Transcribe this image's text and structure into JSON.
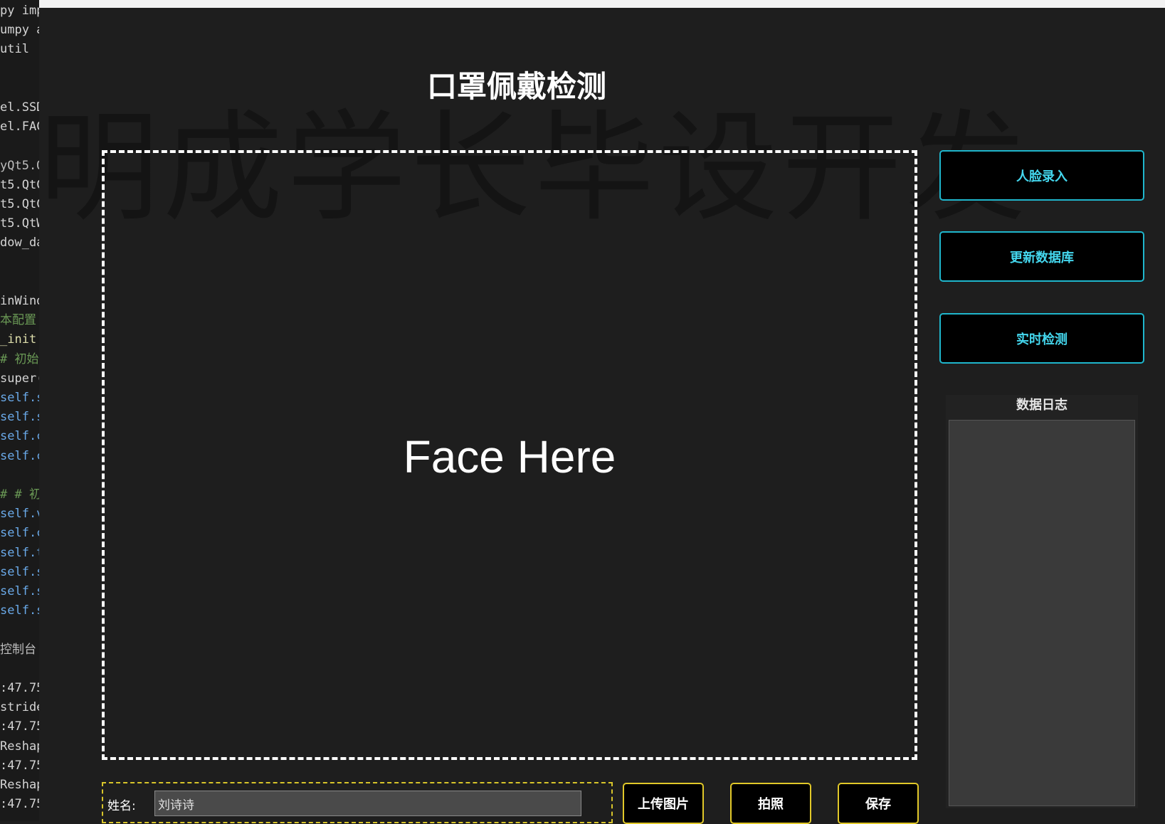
{
  "editor_lines": [
    {
      "text": "py imp",
      "cls": "c-white"
    },
    {
      "text": "umpy a",
      "cls": "c-white"
    },
    {
      "text": "util",
      "cls": "c-white"
    },
    {
      "text": "",
      "cls": "c-white"
    },
    {
      "text": "",
      "cls": "c-white"
    },
    {
      "text": "el.SSD",
      "cls": "c-white"
    },
    {
      "text": "el.FAC",
      "cls": "c-white"
    },
    {
      "text": "",
      "cls": "c-white"
    },
    {
      "text": "yQt5.Q",
      "cls": "c-gray"
    },
    {
      "text": "t5.QtC",
      "cls": "c-white"
    },
    {
      "text": "t5.QtC",
      "cls": "c-white"
    },
    {
      "text": "t5.QtW",
      "cls": "c-white"
    },
    {
      "text": "dow_da",
      "cls": "c-white"
    },
    {
      "text": "",
      "cls": "c-white"
    },
    {
      "text": "",
      "cls": "c-white"
    },
    {
      "text": "inWind",
      "cls": "c-white"
    },
    {
      "text": "本配置",
      "cls": "c-green"
    },
    {
      "text": "_init",
      "cls": "c-yellow"
    },
    {
      "text": "# 初始",
      "cls": "c-green"
    },
    {
      "text": "super(",
      "cls": "c-white"
    },
    {
      "text": "self.s",
      "cls": "c-blue"
    },
    {
      "text": "self.s",
      "cls": "c-blue"
    },
    {
      "text": "self.c",
      "cls": "c-blue"
    },
    {
      "text": "self.c",
      "cls": "c-blue"
    },
    {
      "text": "",
      "cls": "c-white"
    },
    {
      "text": "# # 初",
      "cls": "c-green"
    },
    {
      "text": "self.v",
      "cls": "c-blue"
    },
    {
      "text": "self.c",
      "cls": "c-blue"
    },
    {
      "text": "self.t",
      "cls": "c-blue"
    },
    {
      "text": "self.s",
      "cls": "c-blue"
    },
    {
      "text": "self.s",
      "cls": "c-blue"
    },
    {
      "text": "self.s",
      "cls": "c-blue"
    },
    {
      "text": "",
      "cls": "c-white"
    },
    {
      "text": "控制台",
      "cls": "c-gray"
    },
    {
      "text": "",
      "cls": "c-white"
    },
    {
      "text": ":47.75",
      "cls": "c-white"
    },
    {
      "text": "stride",
      "cls": "c-white"
    },
    {
      "text": ":47.75",
      "cls": "c-white"
    },
    {
      "text": "Reshap",
      "cls": "c-white"
    },
    {
      "text": ":47.75",
      "cls": "c-white"
    },
    {
      "text": "Reshap",
      "cls": "c-white"
    },
    {
      "text": ":47.75",
      "cls": "c-white"
    }
  ],
  "app": {
    "watermark": "明成学长毕设开发",
    "title": "口罩佩戴检测",
    "face_label": "Face Here",
    "buttons": {
      "face_entry": "人脸录入",
      "update_db": "更新数据库",
      "realtime": "实时检测",
      "upload": "上传图片",
      "photo": "拍照",
      "save": "保存"
    },
    "log_title": "数据日志",
    "name_label": "姓名:",
    "name_value": "刘诗诗"
  }
}
